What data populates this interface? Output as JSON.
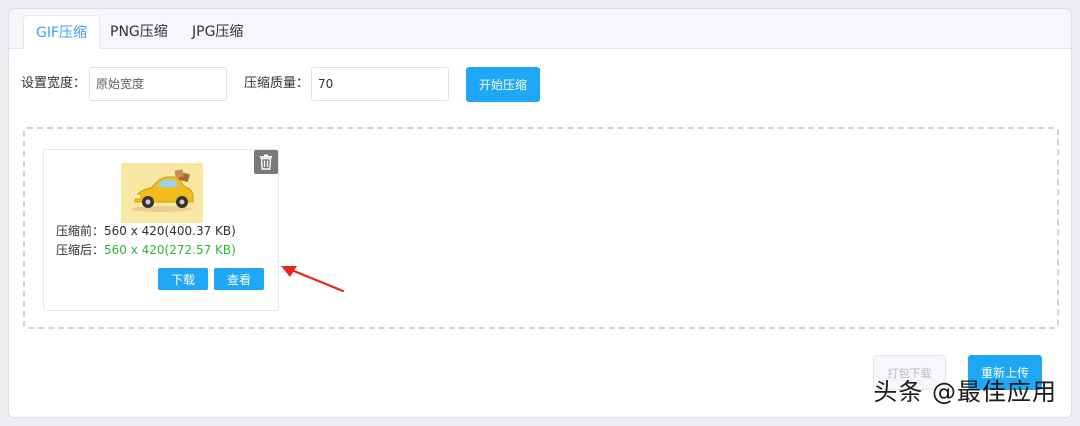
{
  "tabs": [
    {
      "label": "GIF压缩",
      "active": true
    },
    {
      "label": "PNG压缩",
      "active": false
    },
    {
      "label": "JPG压缩",
      "active": false
    }
  ],
  "settings": {
    "width_label": "设置宽度：",
    "width_placeholder": "原始宽度",
    "quality_label": "压缩质量：",
    "quality_value": "70",
    "start_button": "开始压缩"
  },
  "file_card": {
    "before_label": "压缩前：",
    "before_value": "560 x 420(400.37 KB)",
    "after_label": "压缩后：",
    "after_value": "560 x 420(272.57 KB)",
    "download_button": "下载",
    "view_button": "查看"
  },
  "footer": {
    "pack_download": "打包下载",
    "reupload": "重新上传"
  },
  "watermark": "头条 @最佳应用",
  "colors": {
    "accent": "#1ea7f5",
    "tab_active": "#409eff",
    "success": "#2ab933",
    "annotation_arrow": "#e8251f"
  }
}
